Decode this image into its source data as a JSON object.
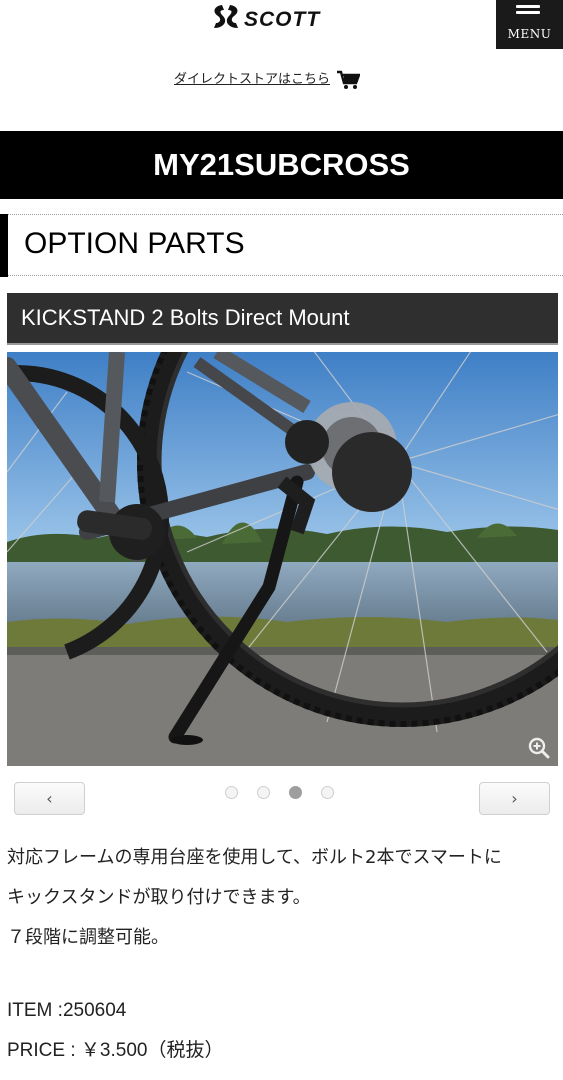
{
  "header": {
    "logo_text": "SCOTT",
    "menu_label": "MENU",
    "store_link": "ダイレクトストアはこちら"
  },
  "page": {
    "title": "MY21SUBCROSS",
    "section": "OPTION PARTS"
  },
  "product": {
    "name": "KICKSTAND 2 Bolts Direct Mount",
    "description": [
      "対応フレームの専用台座を使用して、ボルト2本でスマートに",
      "キックスタンドが取り付けできます。",
      "７段階に調整可能。"
    ],
    "item": "ITEM :250604",
    "price": "PRICE : ￥3.500（税抜）"
  },
  "carousel": {
    "prev_label": "‹",
    "next_label": "›",
    "slide_count": 4,
    "active_index": 2
  },
  "colors": {
    "title_bar": "#000000",
    "product_bar": "#2f2f2f",
    "menu_bg": "#1a1a1a"
  },
  "icons": [
    "scott-logo",
    "menu-icon",
    "cart-icon",
    "zoom-in-icon"
  ]
}
